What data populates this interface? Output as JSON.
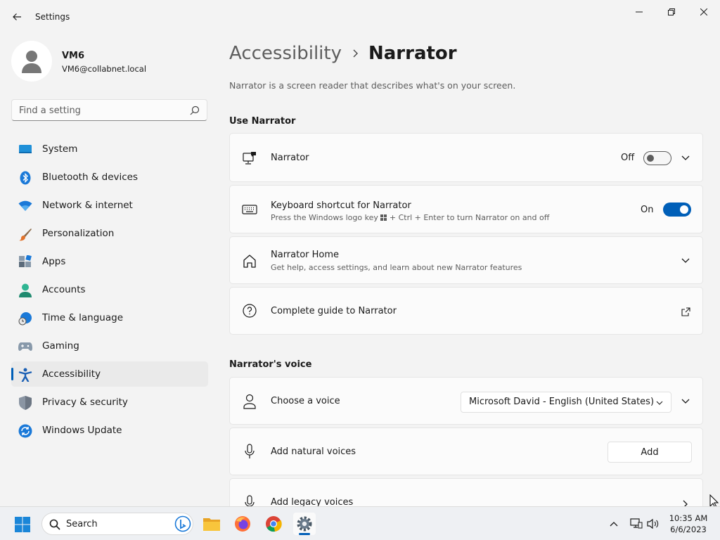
{
  "window": {
    "title": "Settings"
  },
  "user": {
    "name": "VM6",
    "email": "VM6@collabnet.local"
  },
  "search": {
    "placeholder": "Find a setting"
  },
  "sidebar": {
    "items": [
      {
        "label": "System",
        "icon": "monitor-icon"
      },
      {
        "label": "Bluetooth & devices",
        "icon": "bluetooth-icon"
      },
      {
        "label": "Network & internet",
        "icon": "wifi-icon"
      },
      {
        "label": "Personalization",
        "icon": "brush-icon"
      },
      {
        "label": "Apps",
        "icon": "apps-icon"
      },
      {
        "label": "Accounts",
        "icon": "person-icon"
      },
      {
        "label": "Time & language",
        "icon": "globe-clock-icon"
      },
      {
        "label": "Gaming",
        "icon": "gamepad-icon"
      },
      {
        "label": "Accessibility",
        "icon": "accessibility-icon",
        "active": true
      },
      {
        "label": "Privacy & security",
        "icon": "shield-icon"
      },
      {
        "label": "Windows Update",
        "icon": "update-icon"
      }
    ]
  },
  "breadcrumb": {
    "parent": "Accessibility",
    "current": "Narrator"
  },
  "page": {
    "description": "Narrator is a screen reader that describes what's on your screen."
  },
  "sections": {
    "use_narrator": {
      "title": "Use Narrator",
      "narrator": {
        "title": "Narrator",
        "state_label": "Off",
        "enabled": false
      },
      "shortcut": {
        "title": "Keyboard shortcut for Narrator",
        "subtitle_before": "Press the Windows logo key",
        "subtitle_after": "+ Ctrl + Enter to turn Narrator on and off",
        "state_label": "On",
        "enabled": true
      },
      "home": {
        "title": "Narrator Home",
        "subtitle": "Get help, access settings, and learn about new Narrator features"
      },
      "guide": {
        "title": "Complete guide to Narrator"
      }
    },
    "voice": {
      "title": "Narrator's voice",
      "choose": {
        "title": "Choose a voice",
        "selected": "Microsoft David - English (United States)"
      },
      "natural": {
        "title": "Add natural voices",
        "button": "Add"
      },
      "legacy": {
        "title": "Add legacy voices"
      }
    }
  },
  "taskbar": {
    "search_label": "Search",
    "apps": [
      "file-explorer-icon",
      "firefox-icon",
      "chrome-icon",
      "settings-icon"
    ],
    "clock": {
      "time": "10:35 AM",
      "date": "6/6/2023"
    }
  },
  "colors": {
    "accent": "#005fb8",
    "background": "#f3f3f3",
    "card": "#fbfbfb"
  }
}
